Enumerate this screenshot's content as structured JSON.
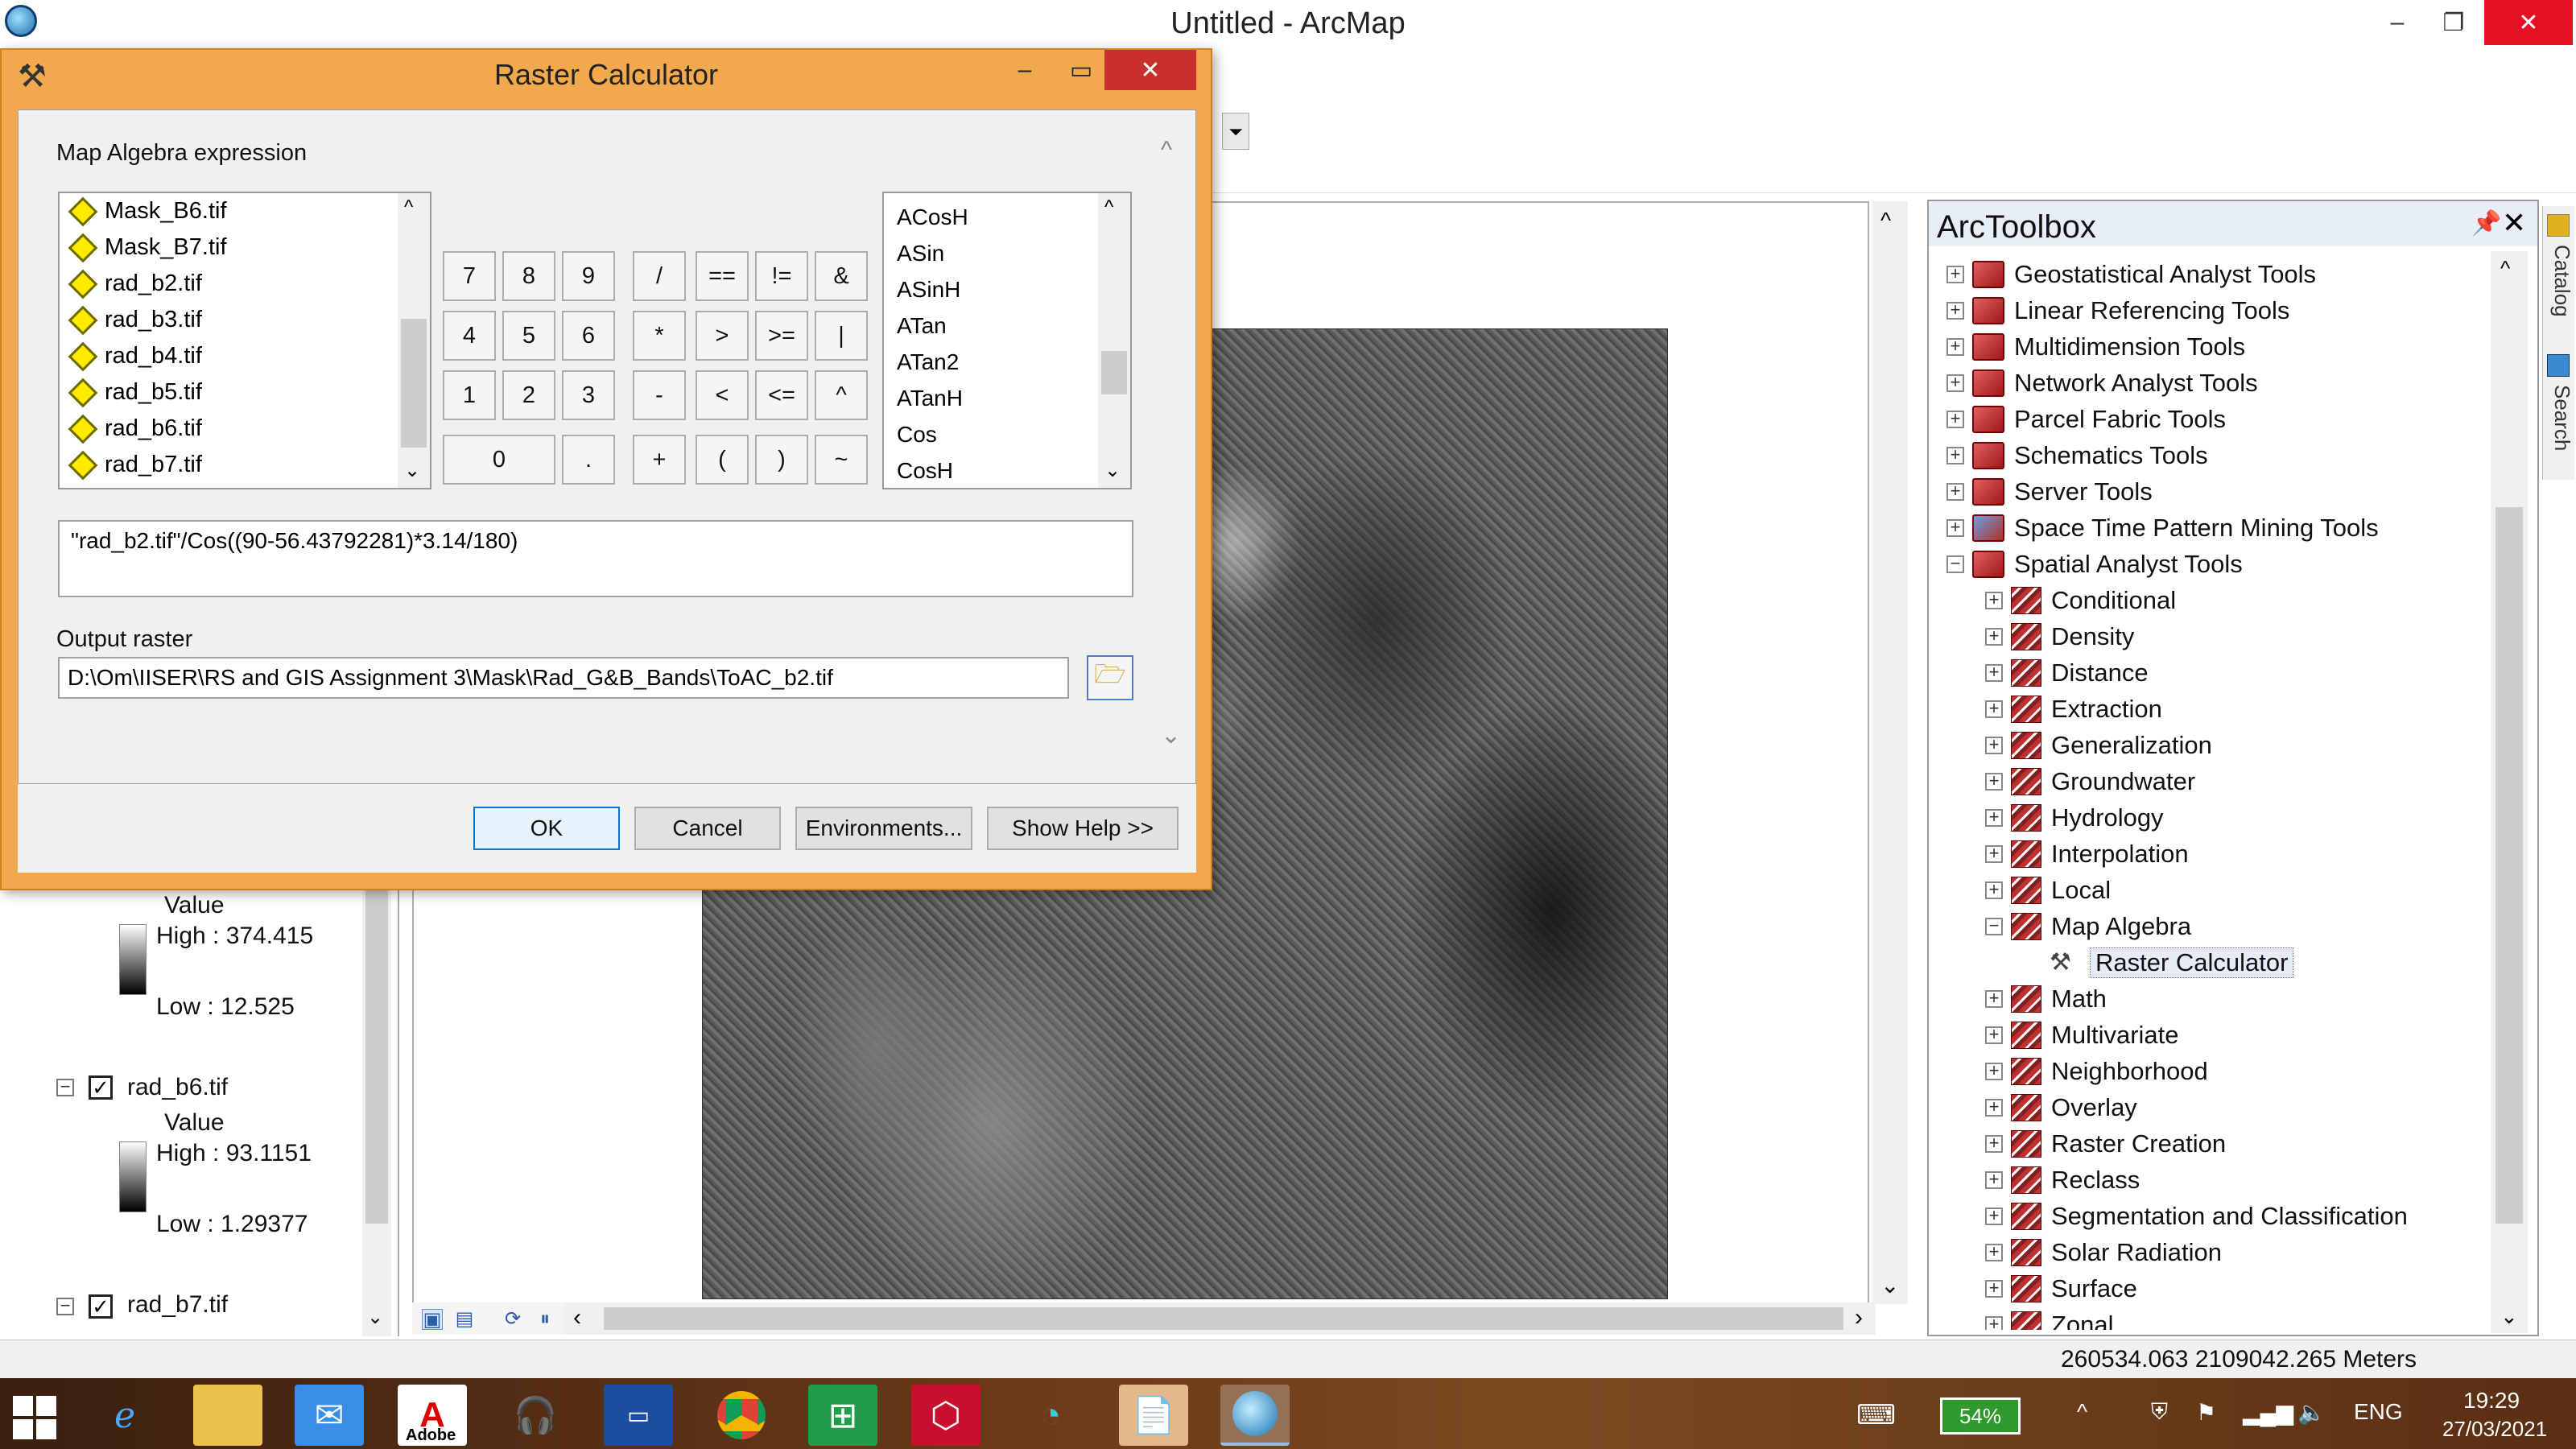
{
  "app": {
    "title": "Untitled - ArcMap"
  },
  "window_controls": {
    "minimize": "–",
    "restore": "❐",
    "close": "✕"
  },
  "dialog": {
    "title": "Raster Calculator",
    "section_label": "Map Algebra expression",
    "layers": [
      "Mask_B6.tif",
      "Mask_B7.tif",
      "rad_b2.tif",
      "rad_b3.tif",
      "rad_b4.tif",
      "rad_b5.tif",
      "rad_b6.tif",
      "rad_b7.tif"
    ],
    "keypad": {
      "row1": [
        "7",
        "8",
        "9",
        "/",
        "==",
        "!=",
        "&"
      ],
      "row2": [
        "4",
        "5",
        "6",
        "*",
        ">",
        ">=",
        "|"
      ],
      "row3": [
        "1",
        "2",
        "3",
        "-",
        "<",
        "<=",
        "^"
      ],
      "row4": [
        "0",
        ".",
        "+",
        "(",
        ")",
        "~"
      ]
    },
    "functions": [
      "ACosH",
      "ASin",
      "ASinH",
      "ATan",
      "ATan2",
      "ATanH",
      "Cos",
      "CosH"
    ],
    "expression": "\"rad_b2.tif\"/Cos((90-56.43792281)*3.14/180)",
    "output_label": "Output raster",
    "output_path": "D:\\Om\\IISER\\RS and GIS Assignment 3\\Mask\\Rad_G&B_Bands\\ToAC_b2.tif",
    "buttons": {
      "ok": "OK",
      "cancel": "Cancel",
      "environments": "Environments...",
      "show_help": "Show Help >>"
    }
  },
  "toc": {
    "legend1": {
      "value_label": "Value",
      "high": "High : 374.415",
      "low": "Low : 12.525"
    },
    "layer_b6": {
      "name": "rad_b6.tif",
      "value_label": "Value",
      "high": "High : 93.1151",
      "low": "Low : 1.29377"
    },
    "layer_b7": {
      "name": "rad_b7.tif"
    }
  },
  "toolbox": {
    "title": "ArcToolbox",
    "top_items": [
      "Geostatistical Analyst Tools",
      "Linear Referencing Tools",
      "Multidimension Tools",
      "Network Analyst Tools",
      "Parcel Fabric Tools",
      "Schematics Tools",
      "Server Tools",
      "Space Time Pattern Mining Tools",
      "Spatial Analyst Tools"
    ],
    "spatial_children": [
      "Conditional",
      "Density",
      "Distance",
      "Extraction",
      "Generalization",
      "Groundwater",
      "Hydrology",
      "Interpolation",
      "Local",
      "Map Algebra"
    ],
    "map_algebra_child": "Raster Calculator",
    "more_children": [
      "Math",
      "Multivariate",
      "Neighborhood",
      "Overlay",
      "Raster Creation",
      "Reclass",
      "Segmentation and Classification",
      "Solar Radiation",
      "Surface",
      "Zonal"
    ]
  },
  "side_tabs": {
    "catalog": "Catalog",
    "search": "Search"
  },
  "status": {
    "coords": "260534.063  2109042.265 Meters"
  },
  "taskbar": {
    "battery": "54%",
    "language": "ENG",
    "time": "19:29",
    "date": "27/03/2021",
    "adobe_label": "Adobe"
  }
}
